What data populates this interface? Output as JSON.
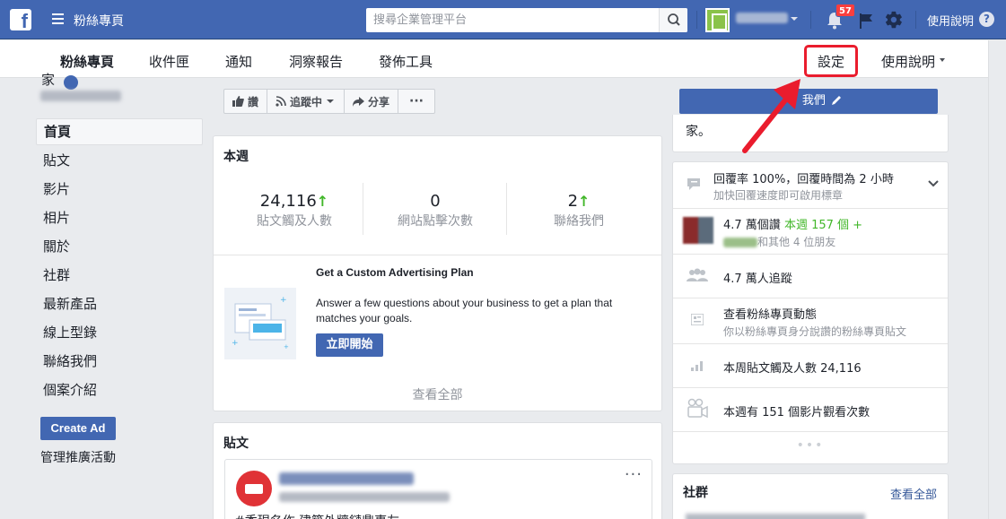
{
  "topbar": {
    "logo": "f",
    "page_title": "粉絲專頁",
    "search_placeholder": "搜尋企業管理平台",
    "notification_count": "57",
    "help_label": "使用說明",
    "help_icon_glyph": "?"
  },
  "tabs": [
    {
      "label": "粉絲專頁"
    },
    {
      "label": "收件匣"
    },
    {
      "label": "通知"
    },
    {
      "label": "洞察報告"
    },
    {
      "label": "發佈工具"
    },
    {
      "label": "設定"
    },
    {
      "label": "使用說明"
    }
  ],
  "sidebar": {
    "page_name_partial": "家",
    "items": [
      {
        "label": "首頁"
      },
      {
        "label": "貼文"
      },
      {
        "label": "影片"
      },
      {
        "label": "相片"
      },
      {
        "label": "關於"
      },
      {
        "label": "社群"
      },
      {
        "label": "最新產品"
      },
      {
        "label": "線上型錄"
      },
      {
        "label": "聯絡我們"
      },
      {
        "label": "個案介紹"
      }
    ],
    "create_ad": "Create Ad",
    "manage_promotions": "管理推廣活動"
  },
  "actions": {
    "like": "讚",
    "following": "追蹤中",
    "share": "分享",
    "more": "···",
    "edit_partial": "我們"
  },
  "this_week": {
    "title": "本週",
    "stats": [
      {
        "value": "24,116",
        "label": "貼文觸及人數"
      },
      {
        "value": "0",
        "label": "網站點擊次數"
      },
      {
        "value": "2",
        "label": "聯絡我們"
      }
    ],
    "promo": {
      "title": "Get a Custom Advertising Plan",
      "body": "Answer a few questions about your business to get a plan that matches your goals.",
      "button": "立即開始"
    },
    "see_all": "查看全部"
  },
  "posts": {
    "title": "貼文",
    "more": "···",
    "preview_text": "#香現名作 建築外牆鏈鼎事友"
  },
  "about": {
    "text_end": "家。"
  },
  "info": {
    "response_rate": "回覆率 100%，回覆時間為 2 小時",
    "response_tip": "加快回覆速度即可啟用標章",
    "likes_prefix": "4.7 萬個讚",
    "likes_week": "本週 157 個 +",
    "likes_friends": "和其他 4 位朋友",
    "followers": "4.7 萬人追蹤",
    "view_activity": "查看粉絲專頁動態",
    "view_activity_sub": "你以粉絲專頁身分說讚的粉絲專頁貼文",
    "reach": "本周貼文觸及人數 24,116",
    "video_views": "本週有 151 個影片觀看次數",
    "dots": "•••"
  },
  "community": {
    "title": "社群",
    "see_all": "查看全部"
  }
}
